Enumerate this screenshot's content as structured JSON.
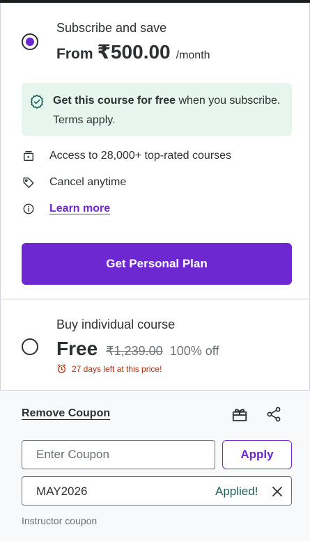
{
  "colors": {
    "accent": "#6d28d2",
    "success": "#1e6055",
    "urgent": "#b32d0f",
    "free_bg": "#e6f6ef"
  },
  "subscription": {
    "label": "Subscribe and save",
    "price_prefix": "From",
    "price": "₹500.00",
    "period": "/month",
    "selected": true
  },
  "free_banner": {
    "bold": "Get this course for free",
    "text": " when you subscribe. Terms apply.",
    "icon": "badge-check-icon"
  },
  "features": [
    {
      "icon": "courses-icon",
      "label": "Access to 28,000+ top-rated courses"
    },
    {
      "icon": "tag-icon",
      "label": "Cancel anytime"
    },
    {
      "icon": "info-icon",
      "label": "Learn more"
    }
  ],
  "primary_button": "Get Personal Plan",
  "individual": {
    "label": "Buy individual course",
    "price": "Free",
    "original_price": "₹1,239.00",
    "discount": "100% off",
    "timer": "27 days left at this price!",
    "selected": false
  },
  "coupon": {
    "remove_label": "Remove Coupon",
    "input_placeholder": "Enter Coupon",
    "apply_label": "Apply",
    "applied_code": "MAY2026",
    "applied_status": "Applied!",
    "note": "Instructor coupon"
  }
}
